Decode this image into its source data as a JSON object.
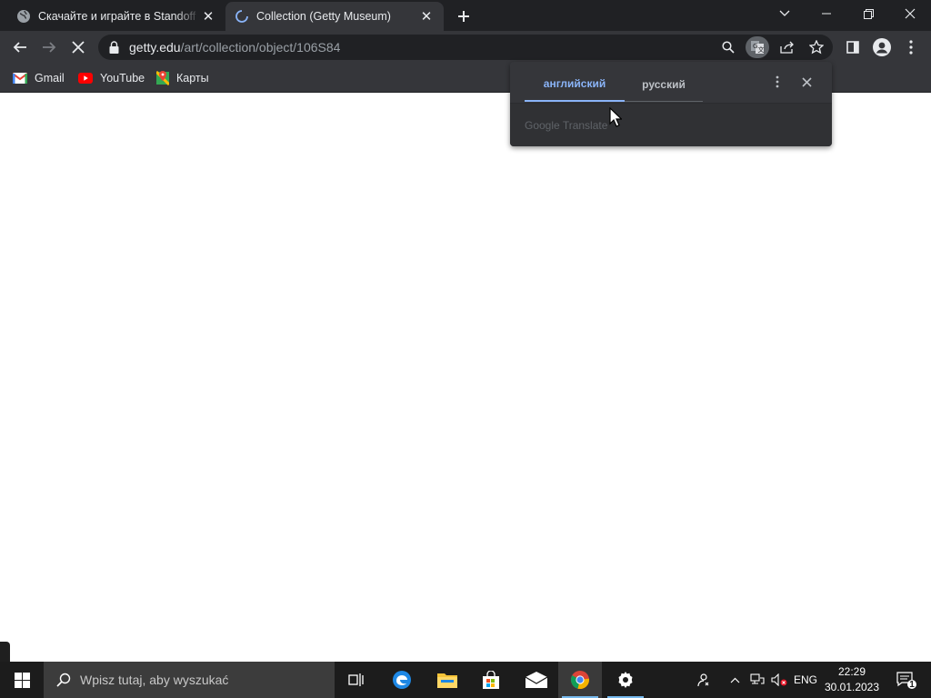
{
  "browser": {
    "tabs": [
      {
        "title": "Скачайте и играйте в Standoff 2",
        "state": "inactive",
        "icon": "globe-icon"
      },
      {
        "title": "Collection (Getty Museum)",
        "state": "active-loading",
        "icon": "loading-spinner-icon"
      }
    ],
    "address": {
      "host": "getty.edu",
      "path": "/art/collection/object/106S84"
    },
    "bookmarks": [
      {
        "label": "Gmail",
        "icon": "gmail-icon"
      },
      {
        "label": "YouTube",
        "icon": "youtube-icon"
      },
      {
        "label": "Карты",
        "icon": "maps-icon"
      }
    ],
    "window_controls": [
      "tab-search",
      "minimize",
      "restore",
      "close"
    ]
  },
  "translate_popup": {
    "source_language": "английский",
    "target_language": "русский",
    "brand": "Google Translate",
    "accent_color": "#8ab4f8"
  },
  "taskbar": {
    "search_placeholder": "Wpisz tutaj, aby wyszukać",
    "apps": [
      "task-view",
      "edge",
      "file-explorer",
      "store",
      "mail",
      "chrome",
      "settings"
    ],
    "language": "ENG",
    "time": "22:29",
    "date": "30.01.2023",
    "notification_count": "1"
  },
  "colors": {
    "tabstrip": "#202124",
    "toolbar": "#35363a",
    "taskbar": "#1c1c1c",
    "page": "#ffffff"
  }
}
